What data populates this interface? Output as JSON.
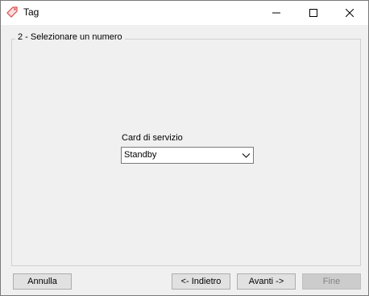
{
  "window": {
    "title": "Tag",
    "icon": "tag-icon",
    "controls": [
      "minimize-icon",
      "maximize-icon",
      "close-icon"
    ]
  },
  "group": {
    "title": "2 - Selezionare un numero"
  },
  "service_card": {
    "label": "Card di servizio",
    "selected": "Standby"
  },
  "buttons": {
    "cancel": "Annulla",
    "back": "<- Indietro",
    "next": "Avanti ->",
    "finish": "Fine",
    "finish_enabled": false
  },
  "colors": {
    "window_bg": "#f0f0f0",
    "titlebar_bg": "#ffffff",
    "disabled_text": "#838383",
    "icon_accent": "#d94a4a"
  }
}
